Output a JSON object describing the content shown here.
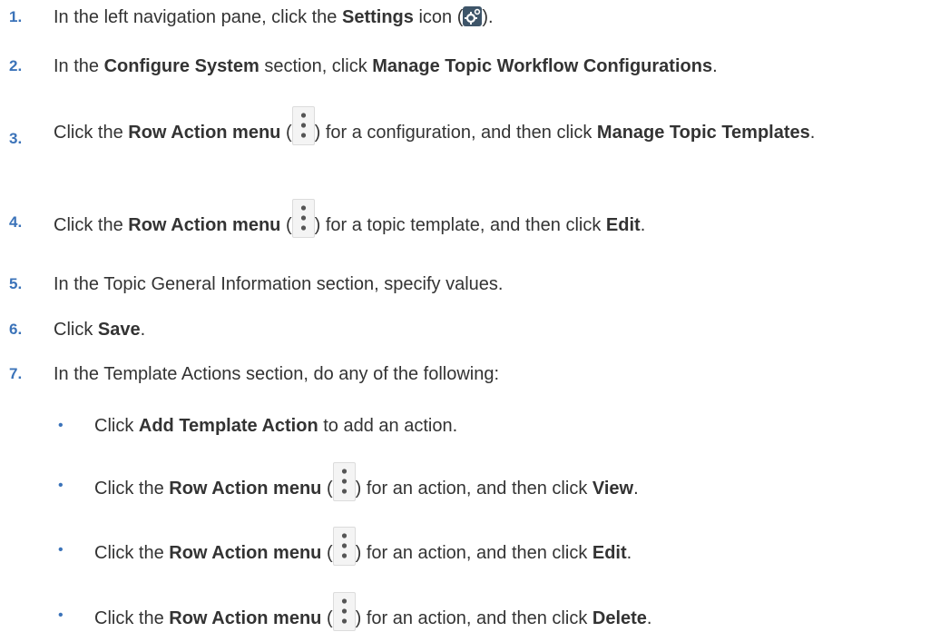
{
  "steps": [
    {
      "num": "1.",
      "parts": [
        "In the left navigation pane, click the ",
        "Settings",
        " icon (",
        ")."
      ]
    },
    {
      "num": "2.",
      "parts": [
        "In the ",
        "Configure System",
        " section, click ",
        "Manage Topic Workflow Configurations",
        "."
      ]
    },
    {
      "num": "3.",
      "parts": [
        "Click the ",
        "Row Action menu",
        " (",
        ") for a configuration, and then click ",
        "Manage Topic Templates",
        "."
      ]
    },
    {
      "num": "4.",
      "parts": [
        "Click the ",
        "Row Action menu",
        " (",
        ") for a topic template, and then click ",
        "Edit",
        "."
      ]
    },
    {
      "num": "5.",
      "parts": [
        "In the Topic General Information section, specify values."
      ]
    },
    {
      "num": "6.",
      "parts": [
        "Click ",
        "Save",
        "."
      ]
    },
    {
      "num": "7.",
      "parts": [
        "In the Template Actions section, do any of the following:"
      ]
    }
  ],
  "substeps": [
    {
      "bullet": "•",
      "parts": [
        "Click ",
        "Add Template Action",
        " to add an action."
      ]
    },
    {
      "bullet": "•",
      "parts": [
        "Click the ",
        "Row Action menu",
        " (",
        ") for an action, and then click ",
        "View",
        "."
      ]
    },
    {
      "bullet": "•",
      "parts": [
        "Click the ",
        "Row Action menu",
        " (",
        ") for an action, and then click ",
        "Edit",
        "."
      ]
    },
    {
      "bullet": "•",
      "parts": [
        "Click the ",
        "Row Action menu",
        " (",
        ") for an action, and then click ",
        "Delete",
        "."
      ]
    }
  ],
  "icons": {
    "settings": "gear-icon",
    "row_action": "kebab-menu-icon"
  },
  "colors": {
    "step_number": "#3b73b9",
    "text": "#333333",
    "settings_icon_bg": "#3e5569"
  }
}
